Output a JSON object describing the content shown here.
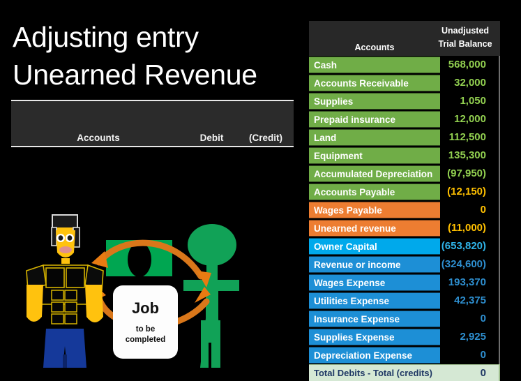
{
  "slide": {
    "title": "Adjusting entry\nUnearned Revenue",
    "background_color": "#000000"
  },
  "journal_entry": {
    "columns": {
      "accounts": "Accounts",
      "debit": "Debit",
      "credit": "(Credit)"
    }
  },
  "illustration": {
    "job_card": {
      "title": "Job",
      "subtitle": "to be\ncompleted"
    },
    "elements": {
      "worker": "yellow-construction-worker",
      "money": "green-cash-bill",
      "customer": "green-stick-figure",
      "arrow_top": "orange-arrow-right",
      "arrow_bottom": "orange-arrow-right"
    },
    "colors": {
      "worker_skin": "#ffc20e",
      "worker_pants": "#1f3f9e",
      "money": "#00a651",
      "customer": "#00a651",
      "arrow": "#e07b10"
    }
  },
  "trial_balance": {
    "header": {
      "accounts": "Accounts",
      "value": "Unadjusted\nTrial Balance"
    },
    "colors": {
      "asset_green": "#70ad47",
      "liability_orange": "#ed7d31",
      "equity_blue": "#00a9eb",
      "expense_blue": "#1d8fd6",
      "total_bg": "#d5e8d4"
    },
    "rows": [
      {
        "label": "Cash",
        "value": "568,000",
        "style": "c-green"
      },
      {
        "label": "Accounts Receivable",
        "value": "32,000",
        "style": "c-green"
      },
      {
        "label": "Supplies",
        "value": "1,050",
        "style": "c-green"
      },
      {
        "label": "Prepaid insurance",
        "value": "12,000",
        "style": "c-green"
      },
      {
        "label": "Land",
        "value": "112,500",
        "style": "c-green"
      },
      {
        "label": "Equipment",
        "value": "135,300",
        "style": "c-green"
      },
      {
        "label": "Accumulated Depreciation",
        "value": "(97,950)",
        "style": "c-green"
      },
      {
        "label": "Accounts Payable",
        "value": "(12,150)",
        "style": "c-green2"
      },
      {
        "label": "Wages Payable",
        "value": "0",
        "style": "c-orange"
      },
      {
        "label": "Unearned revenue",
        "value": "(11,000)",
        "style": "c-orange"
      },
      {
        "label": "Owner Capital",
        "value": "(653,820)",
        "style": "c-blue1"
      },
      {
        "label": "Revenue or income",
        "value": "(324,600)",
        "style": "c-blue2"
      },
      {
        "label": "Wages Expense",
        "value": "193,370",
        "style": "c-blue2"
      },
      {
        "label": "Utilities Expense",
        "value": "42,375",
        "style": "c-blue2"
      },
      {
        "label": "Insurance Expense",
        "value": "0",
        "style": "c-blue2"
      },
      {
        "label": "Supplies Expense",
        "value": "2,925",
        "style": "c-blue2"
      },
      {
        "label": "Depreciation Expense",
        "value": "0",
        "style": "c-blue2"
      }
    ],
    "total_row": {
      "label": "Total Debits - Total (credits)",
      "value": "0"
    }
  }
}
